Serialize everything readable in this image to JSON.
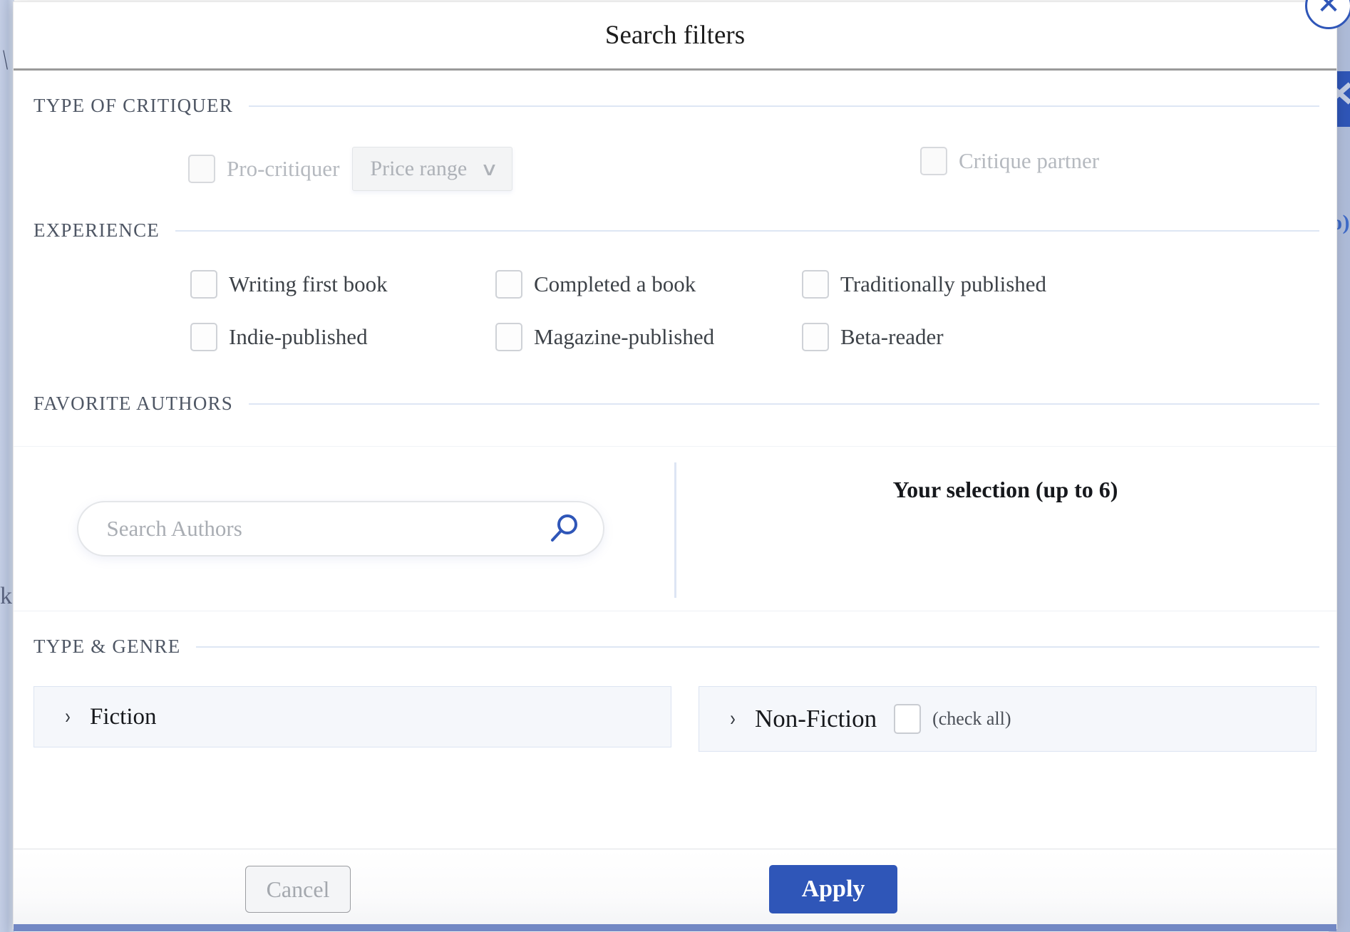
{
  "modal": {
    "title": "Search filters",
    "close_icon": "close-x-icon"
  },
  "sections": {
    "critiquer": {
      "heading": "TYPE OF CRITIQUER",
      "pro_critiquer_label": "Pro-critiquer",
      "price_range_label": "Price range",
      "price_range_caret": "∨",
      "critique_partner_label": "Critique partner"
    },
    "experience": {
      "heading": "EXPERIENCE",
      "options": [
        "Writing first book",
        "Completed a book",
        "Traditionally published",
        "Indie-published",
        "Magazine-published",
        "Beta-reader"
      ]
    },
    "authors": {
      "heading": "FAVORITE AUTHORS",
      "search_placeholder": "Search Authors",
      "search_value": "",
      "search_icon": "search-icon",
      "selection_title": "Your selection (up to 6)"
    },
    "genre": {
      "heading": "TYPE & GENRE",
      "fiction_label": "Fiction",
      "fiction_chevron": "›",
      "nonfiction_label": "Non-Fiction",
      "nonfiction_chevron": "›",
      "check_all_label": "(check all)"
    }
  },
  "footer": {
    "cancel_label": "Cancel",
    "apply_label": "Apply"
  },
  "background": {
    "left_glyph": "k",
    "right_text": "o)",
    "left_chevron": "\\"
  },
  "colors": {
    "accent_blue": "#2f56b8",
    "section_rule": "#dee6f4",
    "genre_card_bg": "#f5f7fb",
    "genre_card_border": "#dce4f2",
    "disabled_text": "#b5b9bf",
    "body_text": "#3d4248"
  }
}
